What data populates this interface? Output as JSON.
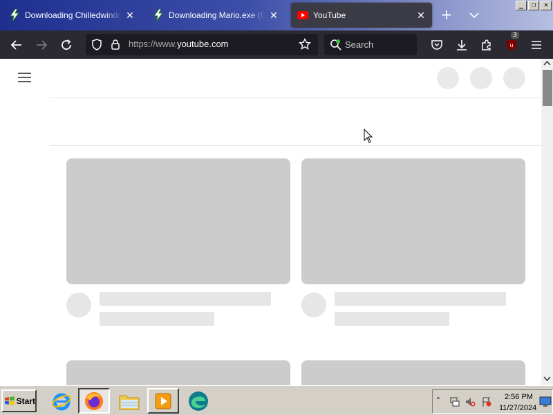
{
  "browser": {
    "tabs": [
      {
        "title": "Downloading Chilledwindows.exe",
        "favicon": "lightning-icon",
        "active": false
      },
      {
        "title": "Downloading Mario.exe (Better",
        "favicon": "lightning-icon",
        "active": false
      },
      {
        "title": "YouTube",
        "favicon": "youtube-icon",
        "active": true
      }
    ],
    "new_tab": "+",
    "window_controls": {
      "minimize": "_",
      "restore": "❐",
      "close": "✕"
    },
    "url": {
      "prefix": "https://www.",
      "domain": "youtube.com"
    },
    "search_placeholder": "Search",
    "extension_badge": "3"
  },
  "page": {
    "cards_loading": true
  },
  "taskbar": {
    "start_label": "Start",
    "apps": [
      "internet-explorer-icon",
      "firefox-icon",
      "file-explorer-icon",
      "media-player-icon",
      "edge-icon"
    ],
    "clock_time": "2:56 PM",
    "clock_date": "11/27/2024"
  },
  "colors": {
    "tabbar_start": "#1f2f8f",
    "toolbar": "#2b2a33",
    "skeleton": "#cccccc",
    "youtube_red": "#ff0000"
  }
}
